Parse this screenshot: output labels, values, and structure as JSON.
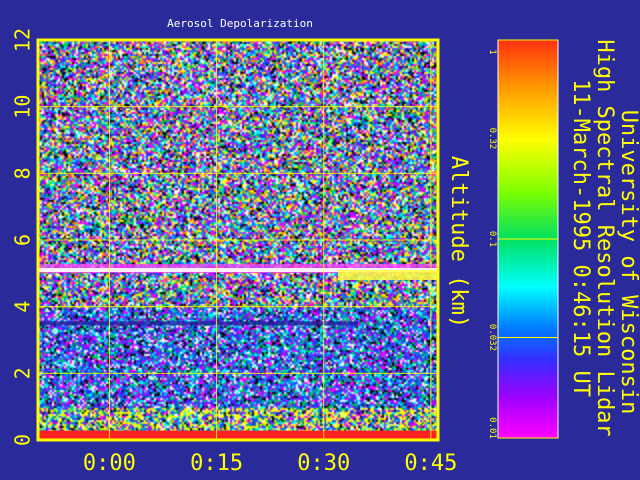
{
  "chart_data": {
    "type": "heatmap",
    "title": "Aerosol Depolarization",
    "ylabel": "Altitude (km)",
    "xlabel": "",
    "x_ticks": [
      "0:00",
      "0:15",
      "0:30",
      "0:45"
    ],
    "x_tick_values": [
      0,
      15,
      30,
      45
    ],
    "x_range": [
      -10,
      46
    ],
    "y_ticks": [
      "0",
      "2",
      "4",
      "6",
      "8",
      "10",
      "12"
    ],
    "y_tick_values": [
      0,
      2,
      4,
      6,
      8,
      10,
      12
    ],
    "y_range": [
      0,
      12
    ],
    "grid": true,
    "layers": [
      {
        "feature": "aerosol layer",
        "altitude_km": 5.1
      },
      {
        "feature": "thin layer",
        "altitude_km": 3.5
      },
      {
        "feature": "surface return",
        "altitude_km": 0.1
      }
    ],
    "colorbar": {
      "scale": "log",
      "range": [
        0.01,
        1
      ],
      "tick_labels": [
        "1",
        "0.32",
        "0.1",
        "0.032",
        "0.01"
      ],
      "tick_values": [
        1,
        0.32,
        0.1,
        0.032,
        0.01
      ]
    }
  },
  "side_title": {
    "line1": "University of Wisconsin",
    "line2": "High Spectral Resolution Lidar",
    "line3": "11-March-1995  0:46:15 UT"
  },
  "colors": {
    "background": "#2a2a9a",
    "frame": "#ffff00",
    "text": "#ffff00",
    "title": "#ffffff"
  }
}
